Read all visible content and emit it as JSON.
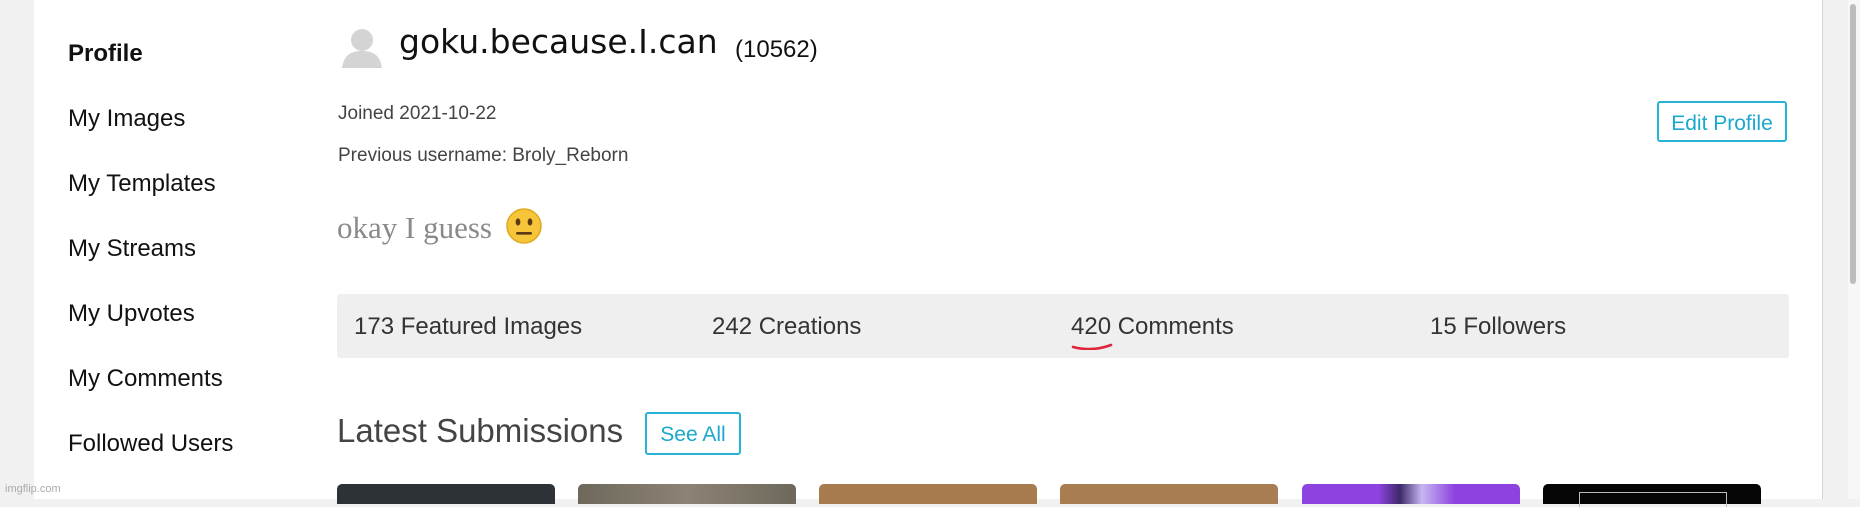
{
  "sidebar": {
    "items": [
      {
        "label": "Profile",
        "active": true
      },
      {
        "label": "My Images"
      },
      {
        "label": "My Templates"
      },
      {
        "label": "My Streams"
      },
      {
        "label": "My Upvotes"
      },
      {
        "label": "My Comments"
      },
      {
        "label": "Followed Users"
      }
    ]
  },
  "profile": {
    "avatar_icon": "user-silhouette-icon",
    "username": "goku.because.I.can",
    "points": "(10562)",
    "joined": "Joined 2021-10-22",
    "previous_username": "Previous username: Broly_Reborn",
    "bio": "okay I guess",
    "bio_emoji": "neutral-face-emoji",
    "edit_label": "Edit Profile"
  },
  "stats": [
    {
      "value": "173",
      "label": "Featured Images"
    },
    {
      "value": "242",
      "label": "Creations"
    },
    {
      "value": "420",
      "label": "Comments"
    },
    {
      "value": "15",
      "label": "Followers"
    }
  ],
  "submissions": {
    "title": "Latest Submissions",
    "see_all_label": "See All"
  },
  "watermark": "imgflip.com",
  "colors": {
    "accent": "#26b3d6",
    "stats_bg": "#efefef",
    "thumbs": [
      "#2d3236",
      "#7b7467",
      "#a87b4f",
      "#a97d52",
      "#8e43e0",
      "#050505"
    ]
  }
}
